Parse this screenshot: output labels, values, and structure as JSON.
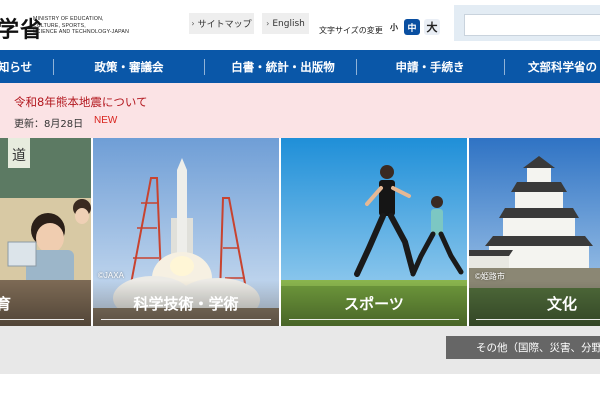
{
  "header": {
    "logo_text": "学省",
    "logo_english": [
      "MINISTRY OF EDUCATION,",
      "CULTURE, SPORTS,",
      "SCIENCE AND TECHNOLOGY-JAPAN"
    ],
    "sitemap_label": "サイトマップ",
    "english_label": "English",
    "font_size_label": "文字サイズの変更",
    "font_small": "小",
    "font_medium": "中",
    "font_large": "大",
    "search_value": "",
    "search_placeholder": ""
  },
  "nav": {
    "items": [
      "知らせ",
      "政策・審議会",
      "白書・統計・出版物",
      "申請・手続き",
      "文部科学省の"
    ]
  },
  "notice": {
    "title": "令和8年熊本地震について",
    "updated": "更新：8月28日",
    "badge": "NEW"
  },
  "tiles": [
    {
      "label": "育",
      "credit": ""
    },
    {
      "label": "科学技術・学術",
      "credit": "©JAXA"
    },
    {
      "label": "スポーツ",
      "credit": ""
    },
    {
      "label": "文化",
      "credit": "©姫路市"
    }
  ],
  "other_button": "その他（国際、災害、分野横断",
  "colors": {
    "nav_blue": "#0a57a8",
    "notice_bg": "#fbe3e5",
    "notice_red": "#b3181f",
    "new_red": "#d9231d",
    "font_active": "#0a4fa1"
  },
  "icons": [
    "chevron-right-icon"
  ]
}
